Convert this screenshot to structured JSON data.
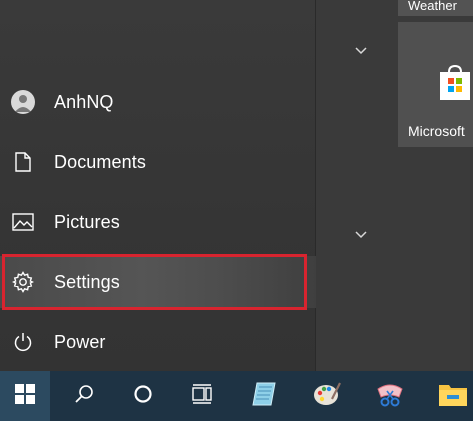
{
  "start_menu": {
    "items": [
      {
        "name": "user",
        "label": "AnhNQ"
      },
      {
        "name": "documents",
        "label": "Documents"
      },
      {
        "name": "pictures",
        "label": "Pictures"
      },
      {
        "name": "settings",
        "label": "Settings",
        "highlighted": true
      },
      {
        "name": "power",
        "label": "Power"
      }
    ]
  },
  "tiles": {
    "weather_label": "Weather",
    "store_label": "Microsoft"
  },
  "taskbar": {
    "icons": [
      "windows-start-icon",
      "search-icon",
      "cortana-icon",
      "task-view-icon",
      "notepad-app-icon",
      "paint-app-icon",
      "snipping-tool-icon",
      "file-explorer-icon"
    ]
  },
  "colors": {
    "highlight_border": "#d8242f",
    "taskbar_bg": "#1e3344",
    "menu_bg": "#353535"
  }
}
